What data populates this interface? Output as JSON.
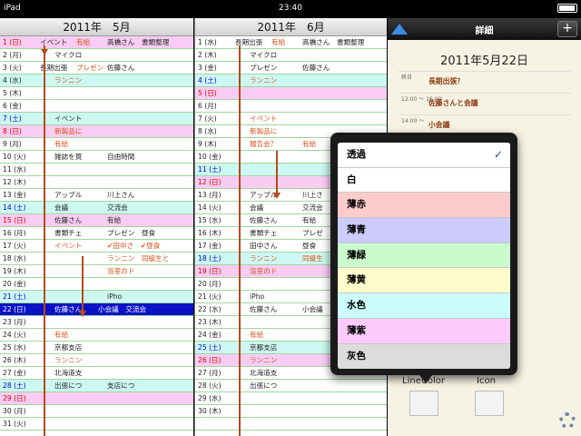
{
  "status_bar": {
    "device": "iPad",
    "time": "23:40"
  },
  "may": {
    "header": "2011年　5月",
    "rows": [
      {
        "d": "1 (日)",
        "t1": "イベント",
        "t1b": "有給",
        "t2": "高橋さん　書類整理",
        "bg": "pink",
        "dc": "red"
      },
      {
        "d": "2 (月)",
        "t1": "マイクロ",
        "t2": ""
      },
      {
        "d": "3 (火)",
        "t1": "長期出張",
        "t1b": "プレゼン",
        "t2": "佐藤さん"
      },
      {
        "d": "4 (水)",
        "t1": "ランニン",
        "t2": "",
        "bg": "cyan",
        "or": true
      },
      {
        "d": "5 (木)",
        "t1": "",
        "t2": ""
      },
      {
        "d": "6 (金)",
        "t1": "",
        "t2": ""
      },
      {
        "d": "7 (土)",
        "t1": "イベント",
        "t2": "",
        "bg": "cyan",
        "dc": "blue"
      },
      {
        "d": "8 (日)",
        "t1": "新製品に",
        "t2": "",
        "bg": "pink",
        "dc": "red",
        "or": true
      },
      {
        "d": "9 (月)",
        "t1": "有給",
        "t2": "",
        "or": true
      },
      {
        "d": "10 (火)",
        "t1": "雑誌を買",
        "t2": "自由時間"
      },
      {
        "d": "11 (水)",
        "t1": "",
        "t2": ""
      },
      {
        "d": "12 (木)",
        "t1": "",
        "t2": ""
      },
      {
        "d": "13 (金)",
        "t1": "アップル",
        "t2": "川上さん"
      },
      {
        "d": "14 (土)",
        "t1": "会議",
        "t2": "交流会",
        "bg": "cyan",
        "dc": "blue"
      },
      {
        "d": "15 (日)",
        "t1": "佐藤さん",
        "t2": "有給",
        "bg": "pink",
        "dc": "red"
      },
      {
        "d": "16 (月)",
        "t1": "書類チェ",
        "t2": "プレゼン　昼食"
      },
      {
        "d": "17 (火)",
        "t1": "イベント",
        "t2": "✔田中さ　✔昼食",
        "or": true
      },
      {
        "d": "18 (水)",
        "t1": "",
        "t2": "ランニン　同級生と",
        "or": true
      },
      {
        "d": "19 (木)",
        "t1": "",
        "t2": "浴室のド",
        "or": true
      },
      {
        "d": "20 (金)",
        "t1": "",
        "t2": ""
      },
      {
        "d": "21 (土)",
        "t1": "",
        "t2": "iPho",
        "bg": "cyan",
        "dc": "blue"
      },
      {
        "d": "22 (日)",
        "t1": "佐藤さん",
        "t2": "小会議　交流会",
        "bg": "blue"
      },
      {
        "d": "23 (月)",
        "t1": "",
        "t2": ""
      },
      {
        "d": "24 (火)",
        "t1": "有給",
        "t2": "",
        "or": true
      },
      {
        "d": "25 (水)",
        "t1": "京都支店",
        "t2": ""
      },
      {
        "d": "26 (木)",
        "t1": "ランニン",
        "t2": "",
        "or": true
      },
      {
        "d": "27 (金)",
        "t1": "北海道支",
        "t2": ""
      },
      {
        "d": "28 (土)",
        "t1": "出張につ",
        "t2": "支店につ",
        "bg": "cyan",
        "dc": "blue"
      },
      {
        "d": "29 (日)",
        "t1": "",
        "t2": "",
        "bg": "pink",
        "dc": "red"
      },
      {
        "d": "30 (月)",
        "t1": "",
        "t2": ""
      },
      {
        "d": "31 (火)",
        "t1": "",
        "t2": ""
      }
    ]
  },
  "jun": {
    "header": "2011年　6月",
    "rows": [
      {
        "d": "1 (水)",
        "t1": "長期出張",
        "t1b": "有給",
        "t2": "高橋さん　書類整理"
      },
      {
        "d": "2 (木)",
        "t1": "マイクロ",
        "t2": ""
      },
      {
        "d": "3 (金)",
        "t1": "プレゼン",
        "t2": "佐藤さん"
      },
      {
        "d": "4 (土)",
        "t1": "ランニン",
        "t2": "",
        "bg": "cyan",
        "dc": "blue",
        "or": true
      },
      {
        "d": "5 (日)",
        "t1": "",
        "t2": "",
        "bg": "pink",
        "dc": "red"
      },
      {
        "d": "6 (月)",
        "t1": "",
        "t2": ""
      },
      {
        "d": "7 (火)",
        "t1": "イベント",
        "t2": "",
        "or": true
      },
      {
        "d": "8 (水)",
        "t1": "新製品に",
        "t2": "",
        "or": true
      },
      {
        "d": "9 (木)",
        "t1": "報告会？",
        "t2": "有給",
        "or": true
      },
      {
        "d": "10 (金)",
        "t1": "",
        "t2": ""
      },
      {
        "d": "11 (土)",
        "t1": "",
        "t2": "",
        "bg": "cyan",
        "dc": "blue"
      },
      {
        "d": "12 (日)",
        "t1": "",
        "t2": "",
        "bg": "pink",
        "dc": "red"
      },
      {
        "d": "13 (月)",
        "t1": "アップル",
        "t2": "川上さ"
      },
      {
        "d": "14 (火)",
        "t1": "会議",
        "t2": "交流会"
      },
      {
        "d": "15 (水)",
        "t1": "佐藤さん",
        "t2": "有給"
      },
      {
        "d": "16 (木)",
        "t1": "書類チェ",
        "t2": "プレゼ"
      },
      {
        "d": "17 (金)",
        "t1": "田中さん",
        "t2": "昼食"
      },
      {
        "d": "18 (土)",
        "t1": "ランニン",
        "t2": "同級生",
        "bg": "cyan",
        "dc": "blue",
        "or": true
      },
      {
        "d": "19 (日)",
        "t1": "浴室のド",
        "t2": "",
        "bg": "pink",
        "dc": "red",
        "or": true
      },
      {
        "d": "20 (月)",
        "t1": "",
        "t2": ""
      },
      {
        "d": "21 (火)",
        "t1": "iPho",
        "t2": ""
      },
      {
        "d": "22 (水)",
        "t1": "佐藤さん",
        "t2": "小会議"
      },
      {
        "d": "23 (木)",
        "t1": "",
        "t2": ""
      },
      {
        "d": "24 (金)",
        "t1": "有給",
        "t2": "",
        "or": true
      },
      {
        "d": "25 (土)",
        "t1": "京都支店",
        "t2": "",
        "bg": "cyan",
        "dc": "blue"
      },
      {
        "d": "26 (日)",
        "t1": "ランニン",
        "t2": "",
        "bg": "pink",
        "dc": "red",
        "or": true
      },
      {
        "d": "27 (月)",
        "t1": "北海道支",
        "t2": ""
      },
      {
        "d": "28 (火)",
        "t1": "出張につ",
        "t2": ""
      },
      {
        "d": "29 (水)",
        "t1": "",
        "t2": ""
      },
      {
        "d": "30 (木)",
        "t1": "",
        "t2": ""
      },
      {
        "d": "",
        "t1": "",
        "t2": ""
      }
    ]
  },
  "detail": {
    "title": "詳細",
    "plus_label": "+",
    "date": "2011年5月22日",
    "events": [
      {
        "time": "終日",
        "name": "長期出張？"
      },
      {
        "time": "12:00 ～ 16:00",
        "name": "佐藤さんと会議"
      },
      {
        "time": "14:00 ～",
        "name": "小会議"
      }
    ],
    "line_color_label": "LineColor",
    "icon_label": "Icon"
  },
  "popover": {
    "options": [
      {
        "label": "透過",
        "color": "#ffffff",
        "checked": true
      },
      {
        "label": "白",
        "color": "#ffffff"
      },
      {
        "label": "薄赤",
        "color": "#fccbcb"
      },
      {
        "label": "薄青",
        "color": "#cccbfb"
      },
      {
        "label": "薄緑",
        "color": "#cbfbcc"
      },
      {
        "label": "薄黄",
        "color": "#fbfbcc"
      },
      {
        "label": "水色",
        "color": "#cbfbfb"
      },
      {
        "label": "薄紫",
        "color": "#fbcbfb"
      },
      {
        "label": "灰色",
        "color": "#dcdcdc"
      }
    ],
    "check_glyph": "✓"
  },
  "colors": {
    "accent_line": "#b74a1b",
    "today": "#0a12c8",
    "sunday_bg": "#f9cdf3",
    "saturday_bg": "#cdf8f1"
  }
}
